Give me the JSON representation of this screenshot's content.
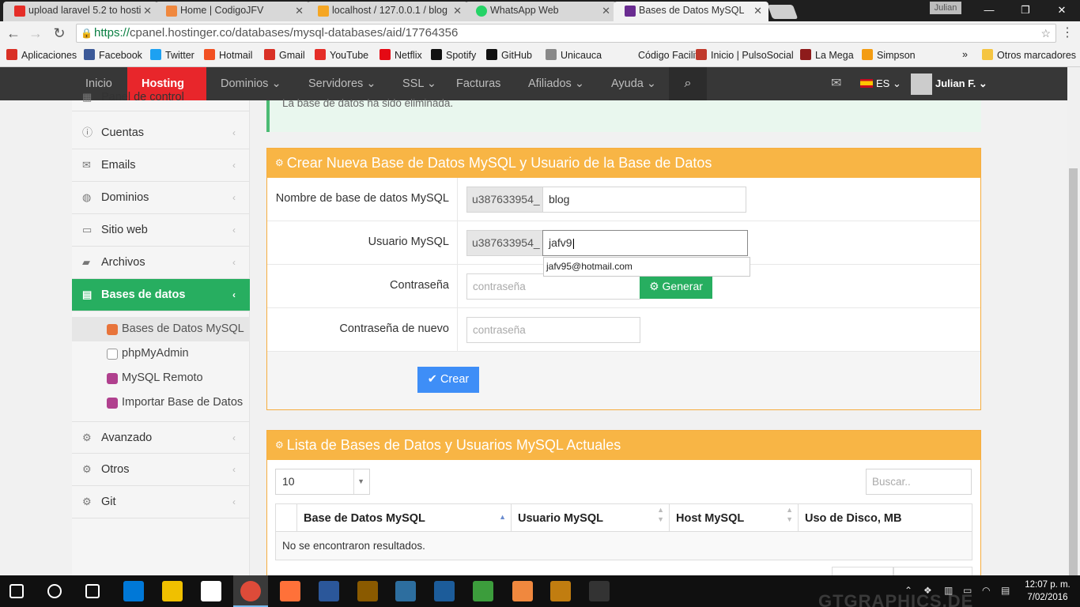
{
  "browser": {
    "tabs": [
      {
        "title": "upload laravel 5.2 to hosti",
        "fav": "#e52d27"
      },
      {
        "title": "Home | CodigoJFV",
        "fav": "#f0883e"
      },
      {
        "title": "localhost / 127.0.0.1 / blog",
        "fav": "#f5a623"
      },
      {
        "title": "WhatsApp Web",
        "fav": "#25d366"
      },
      {
        "title": "Bases de Datos MySQL",
        "fav": "#6a2c91"
      }
    ],
    "user_badge": "Julian",
    "url_https": "https://",
    "url_rest": "cpanel.hostinger.co/databases/mysql-databases/aid/17764356"
  },
  "bookmarks": [
    {
      "label": "Aplicaciones",
      "color": "#d93025"
    },
    {
      "label": "Facebook",
      "color": "#3b5998"
    },
    {
      "label": "Twitter",
      "color": "#1da1f2"
    },
    {
      "label": "Hotmail",
      "color": "#f25022"
    },
    {
      "label": "Gmail",
      "color": "#d93025"
    },
    {
      "label": "YouTube",
      "color": "#e52d27"
    },
    {
      "label": "Netflix",
      "color": "#e50914"
    },
    {
      "label": "Spotify",
      "color": "#111111"
    },
    {
      "label": "GitHub",
      "color": "#111111"
    },
    {
      "label": "Unicauca",
      "color": "#888888"
    },
    {
      "label": "Código Facilito",
      "color": "#f2f2f2"
    },
    {
      "label": "Inicio | PulsoSocial",
      "color": "#c0392b"
    },
    {
      "label": "La Mega",
      "color": "#8e1b1b"
    },
    {
      "label": "Simpson",
      "color": "#f39c12"
    }
  ],
  "bookmarks_more": "»",
  "bookmarks_other": "Otros marcadores",
  "nav": {
    "items": [
      "Inicio",
      "Hosting",
      "Dominios",
      "Servidores",
      "SSL",
      "Facturas",
      "Afiliados",
      "Ayuda"
    ],
    "lang": "ES",
    "user": "Julian F."
  },
  "sidebar": {
    "top_partial": "Panel de control",
    "items": [
      "Cuentas",
      "Emails",
      "Dominios",
      "Sitio web",
      "Archivos",
      "Bases de datos",
      "Avanzado",
      "Otros",
      "Git"
    ],
    "subitems": [
      "Bases de Datos MySQL",
      "phpMyAdmin",
      "MySQL Remoto",
      "Importar Base de Datos"
    ]
  },
  "alert": "La base de datos ha sido eliminada.",
  "create_panel": {
    "title": "Crear Nueva Base de Datos MySQL y Usuario de la Base de Datos",
    "db_label": "Nombre de base de datos MySQL",
    "db_prefix": "u387633954_",
    "db_value": "blog",
    "user_label": "Usuario MySQL",
    "user_prefix": "u387633954_",
    "user_value": "jafv9",
    "autocomplete": "jafv95@hotmail.com",
    "pass_label": "Contraseña",
    "pass_placeholder": "contraseña",
    "generate_label": "Generar",
    "pass2_label": "Contraseña de nuevo",
    "pass2_placeholder": "contraseña",
    "create_label": "Crear"
  },
  "list_panel": {
    "title": "Lista de Bases de Datos y Usuarios MySQL Actuales",
    "page_size": "10",
    "search_placeholder": "Buscar..",
    "columns": [
      "Base de Datos MySQL",
      "Usuario MySQL",
      "Host MySQL",
      "Uso de Disco, MB"
    ],
    "empty": "No se encontraron resultados."
  },
  "taskbar": {
    "time": "12:07 p. m.",
    "date": "7/02/2016",
    "icons": [
      "#ffffff",
      "#0078d7",
      "#f0c000",
      "#ffffff",
      "#dd4b39",
      "#ff7139",
      "#2b579a",
      "#8a5a00",
      "#2d6e9f",
      "#1c5c9a",
      "#3c9d3c",
      "#f0883e",
      "#c17d10",
      "#333333"
    ]
  },
  "watermark": "GTGRAPHICS.DE"
}
